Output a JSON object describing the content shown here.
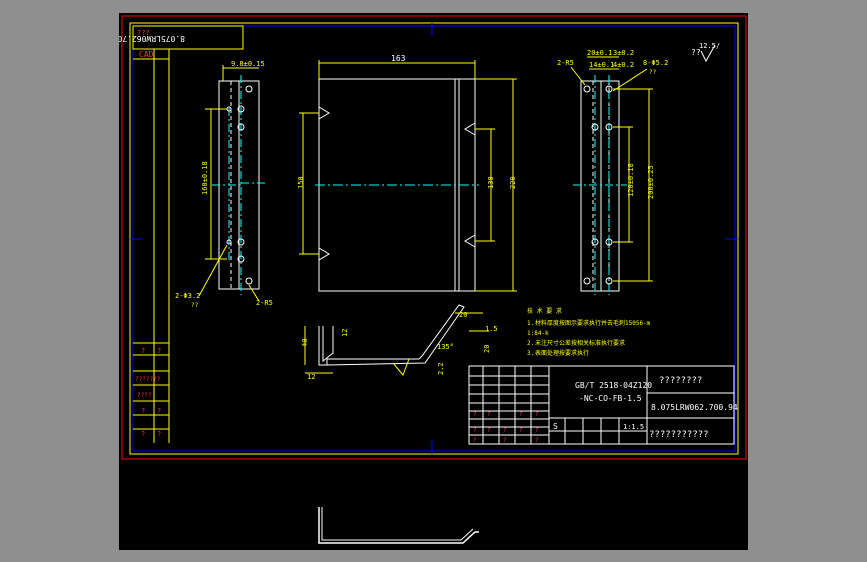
{
  "drawing": {
    "code_top": "8.075LRW062.700.94",
    "cad_label": "CAD",
    "side_question": "???",
    "roughness": "12.5/",
    "roughness_q": "??",
    "colors": {
      "background": "#000000",
      "outline": "#ffffff",
      "dimension": "#ffff00",
      "centerline": "#00ffff",
      "frame": "#ff0000",
      "border": "#0000ff",
      "note": "#ffff00",
      "text_red": "#ff3333"
    }
  },
  "left_view": {
    "dim_top": "9.8±0.15",
    "dim_side": "160±0.18",
    "label_holes": "2-Φ3.2",
    "label_r": "2-R5",
    "label_q": "??"
  },
  "front_view": {
    "dim_width": "163",
    "dim_left": "150",
    "dim_right1": "130",
    "dim_right2": "220"
  },
  "right_view": {
    "label_r": "2-R5",
    "dim_a": "20±0.1",
    "dim_b": "3±0.2",
    "dim_c": "14±0.1",
    "dim_d": "4±0.2",
    "dim_e": "8-Φ5.2",
    "dim_e_q": "??",
    "dim_side1": "120±0.18",
    "dim_side2": "200±0.25"
  },
  "section": {
    "dim_h": "40",
    "dim_w": "12",
    "dim_t": "12",
    "dim_top": "20",
    "dim_angle": "135°",
    "dim_r": "20",
    "dim_thk": "1.5",
    "dim_small": "2.2"
  },
  "notes": {
    "title": "技 术 要 求",
    "line1_pre": "1.",
    "line1": "材料厚度按图示要求执行并去毛刺",
    "line1_code": "15056-m",
    "line2": "1:84-k",
    "line3_pre": "2.",
    "line3": "未注尺寸公差按相关标准执行要求",
    "line4_pre": "3.",
    "line4": "表面处理按要求执行"
  },
  "title_block": {
    "standard": "GB/T 2518-04Z120",
    "spec": "-NC-CO-FB-1.5",
    "name": "????????",
    "code": "8.075LRW062.700.94",
    "company": "???????????",
    "s_label": "S",
    "scale": "1:1.5",
    "cell_q": "?"
  },
  "revision_labels": [
    "?",
    "?",
    "???????",
    "????",
    "?",
    "?",
    "?",
    "?"
  ]
}
